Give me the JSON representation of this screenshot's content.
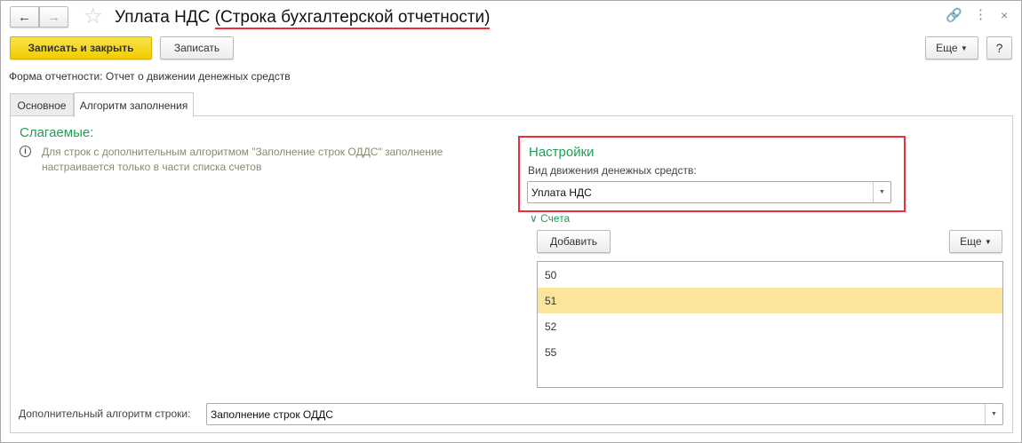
{
  "title": {
    "main": "Уплата НДС",
    "suffix": "(Строка бухгалтерской отчетности)"
  },
  "toolbar": {
    "save_close": "Записать и закрыть",
    "save": "Записать",
    "more": "Еще",
    "help": "?"
  },
  "report_form": "Форма отчетности: Отчет о движении денежных средств",
  "tabs": [
    {
      "label": "Основное",
      "active": false
    },
    {
      "label": "Алгоритм заполнения",
      "active": true
    }
  ],
  "summands": {
    "title": "Слагаемые:",
    "info": "Для строк с дополнительным алгоритмом \"Заполнение строк ОДДС\" заполнение настраивается только в части списка счетов"
  },
  "settings": {
    "title": "Настройки",
    "field_label": "Вид движения денежных средств:",
    "field_value": "Уплата НДС"
  },
  "accounts": {
    "title": "Счета",
    "add": "Добавить",
    "more": "Еще",
    "items": [
      "50",
      "51",
      "52",
      "55"
    ],
    "selected": "51"
  },
  "extra": {
    "label": "Дополнительный алгоритм строки:",
    "value": "Заполнение строк ОДДС"
  },
  "colors": {
    "accent_green": "#1aa255",
    "highlight": "#f02d3a",
    "selected_row": "#fce49a",
    "primary_button": "#f5d40f"
  }
}
